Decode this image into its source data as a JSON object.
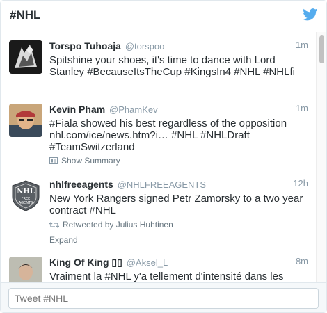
{
  "header": {
    "title": "#NHL",
    "icon": "twitter-bird-icon",
    "brand_color": "#55acee"
  },
  "tweets": [
    {
      "name": "Torspo Tuhoaja",
      "handle": "@torspoo",
      "time": "1m",
      "text": "Spitshine your shoes, it's time to dance with Lord Stanley #BecauseItsTheCup #KingsIn4 #NHL #NHLfi"
    },
    {
      "name": "Kevin Pham",
      "handle": "@PhamKev",
      "time": "1m",
      "text": "#Fiala showed his best regardless of the opposition nhl.com/ice/news.htm?i… #NHL #NHLDraft #TeamSwitzerland",
      "summary_label": "Show Summary"
    },
    {
      "name": "nhlfreeagents",
      "handle": "@NHLFREEAGENTS",
      "time": "12h",
      "text": "New York Rangers signed Petr Zamorsky to a two year contract #NHL",
      "retweet_label": "Retweeted by Julius Huhtinen",
      "expand_label": "Expand"
    },
    {
      "name": "King Of King ▯▯",
      "handle": "@Aksel_L",
      "time": "8m",
      "text": "Vraiment la #NHL y'a tellement d'intensité dans les"
    }
  ],
  "compose": {
    "placeholder": "Tweet #NHL"
  }
}
